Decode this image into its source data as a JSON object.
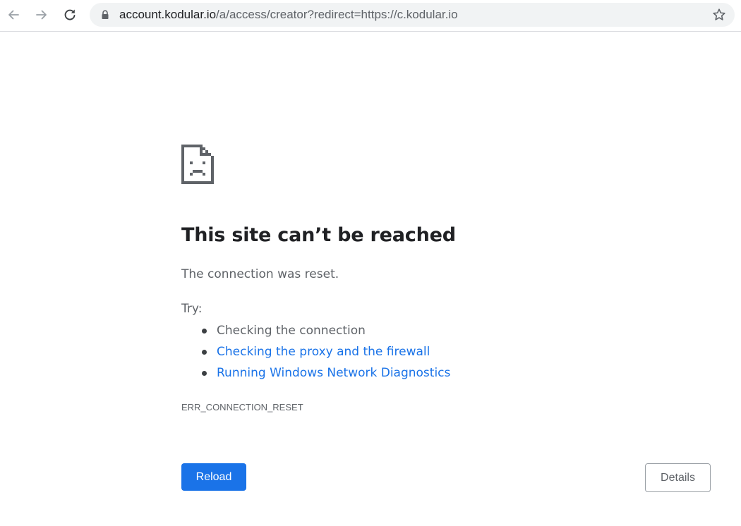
{
  "toolbar": {
    "back_icon": "arrow-left-icon",
    "forward_icon": "arrow-right-icon",
    "reload_icon": "reload-icon",
    "lock_icon": "lock-icon",
    "bookmark_icon": "star-outline-icon",
    "url_host": "account.kodular.io",
    "url_rest": "/a/access/creator?redirect=https://c.kodular.io"
  },
  "error": {
    "icon": "sad-page-icon",
    "headline": "This site can’t be reached",
    "summary": "The connection was reset.",
    "try_label": "Try:",
    "suggestions": [
      {
        "text": "Checking the connection",
        "is_link": false
      },
      {
        "text": "Checking the proxy and the firewall",
        "is_link": true
      },
      {
        "text": "Running Windows Network Diagnostics",
        "is_link": true
      }
    ],
    "code": "ERR_CONNECTION_RESET"
  },
  "buttons": {
    "reload_label": "Reload",
    "details_label": "Details"
  },
  "colors": {
    "accent": "#1a73e8",
    "text_primary": "#202124",
    "text_secondary": "#5f6368"
  }
}
